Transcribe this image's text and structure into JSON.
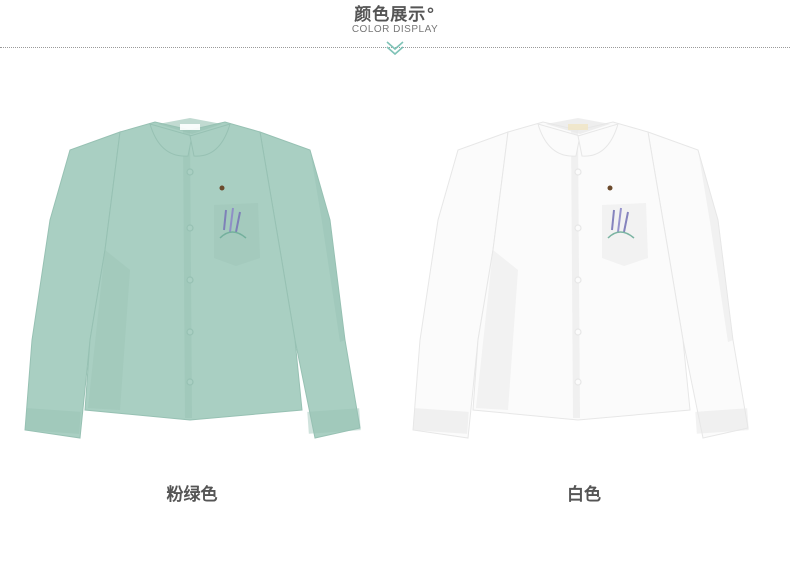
{
  "header": {
    "title": "颜色展示°",
    "subtitle": "COLOR DISPLAY"
  },
  "products": [
    {
      "label": "粉绿色",
      "color": "#a9cfc2",
      "shade": "#97c1b3",
      "icon": "shirt-icon"
    },
    {
      "label": "白色",
      "color": "#fbfbfb",
      "shade": "#e7e7e7",
      "icon": "shirt-icon"
    }
  ],
  "colors": {
    "accent_chevron": "#7fc3b7",
    "text": "#555555",
    "divider": "#9a9a9a"
  }
}
